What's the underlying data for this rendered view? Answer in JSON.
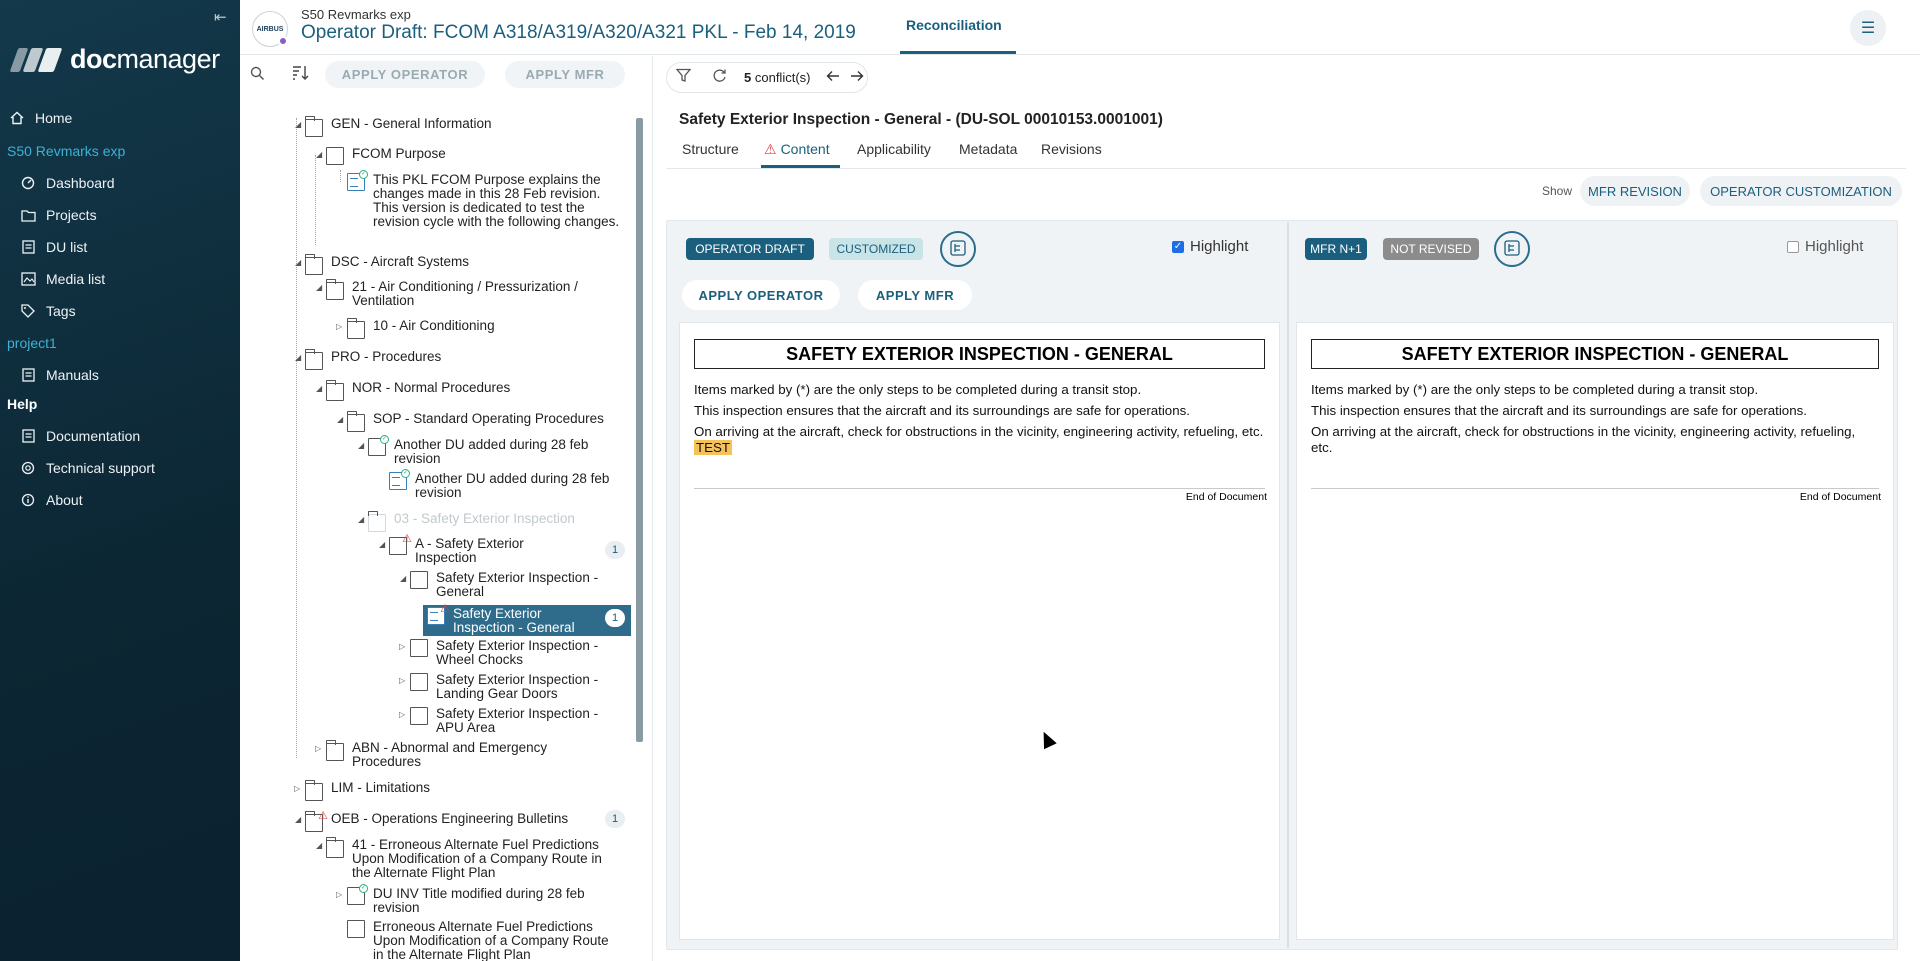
{
  "app": {
    "brand_word_a": "doc",
    "brand_word_b": "manager"
  },
  "sidebar": {
    "items_main": [
      {
        "label": "Home",
        "icon": "home-icon"
      }
    ],
    "section_project": "S50 Revmarks exp",
    "items_project": [
      {
        "label": "Dashboard",
        "icon": "dashboard-icon"
      },
      {
        "label": "Projects",
        "icon": "folder-icon"
      },
      {
        "label": "DU list",
        "icon": "list-icon"
      },
      {
        "label": "Media list",
        "icon": "media-icon"
      },
      {
        "label": "Tags",
        "icon": "tag-icon"
      }
    ],
    "section_project1": "project1",
    "items_project1": [
      {
        "label": "Manuals",
        "icon": "manual-icon"
      }
    ],
    "section_help": "Help",
    "items_help": [
      {
        "label": "Documentation",
        "icon": "document-icon"
      },
      {
        "label": "Technical support",
        "icon": "support-icon"
      },
      {
        "label": "About",
        "icon": "info-icon"
      }
    ]
  },
  "header": {
    "avatar_text": "AIRBUS",
    "breadcrumb": "S50 Revmarks exp",
    "title": "Operator Draft: FCOM A318/A319/A320/A321 PKL - Feb 14, 2019",
    "tab_label": "Reconciliation"
  },
  "tree_toolbar": {
    "apply_operator": "APPLY OPERATOR",
    "apply_mfr": "APPLY MFR"
  },
  "tree": [
    {
      "label": "GEN - General Information"
    },
    {
      "label": "FCOM Purpose"
    },
    {
      "label": "This PKL FCOM Purpose explains the changes made in this 28 Feb revision. This version is dedicated to test the revision cycle with the following changes."
    },
    {
      "label": "DSC - Aircraft Systems"
    },
    {
      "label": "21 - Air Conditioning / Pressurization / Ventilation"
    },
    {
      "label": "10 - Air Conditioning"
    },
    {
      "label": "PRO - Procedures"
    },
    {
      "label": "NOR - Normal Procedures"
    },
    {
      "label": "SOP - Standard Operating Procedures"
    },
    {
      "label": "Another DU added during 28 feb revision"
    },
    {
      "label": "Another DU added during 28 feb revision"
    },
    {
      "label": "03 - Safety Exterior Inspection"
    },
    {
      "label": "A - Safety Exterior Inspection",
      "count": "1"
    },
    {
      "label": "Safety Exterior Inspection - General"
    },
    {
      "label": "Safety Exterior Inspection - General",
      "count": "1"
    },
    {
      "label": "Safety Exterior Inspection - Wheel Chocks"
    },
    {
      "label": "Safety Exterior Inspection - Landing Gear Doors"
    },
    {
      "label": "Safety Exterior Inspection - APU Area"
    },
    {
      "label": "ABN - Abnormal and Emergency Procedures"
    },
    {
      "label": "LIM - Limitations"
    },
    {
      "label": "OEB - Operations Engineering Bulletins",
      "count": "1"
    },
    {
      "label": "41 - Erroneous Alternate Fuel Predictions Upon Modification of a Company Route in the Alternate Flight Plan"
    },
    {
      "label": "DU INV Title modified during 28 feb revision"
    },
    {
      "label": "Erroneous Alternate Fuel Predictions Upon Modification of a Company Route in the Alternate Flight Plan"
    }
  ],
  "conflicts": {
    "count": "5",
    "label": "conflict(s)"
  },
  "du": {
    "title": "Safety Exterior Inspection - General - (DU-SOL 00010153.0001001)",
    "tabs": [
      "Structure",
      "Content",
      "Applicability",
      "Metadata",
      "Revisions"
    ],
    "active_tab": "Content",
    "show_label": "Show",
    "show_mfr": "MFR REVISION",
    "show_operator": "OPERATOR CUSTOMIZATION"
  },
  "left_col": {
    "tag1": "OPERATOR DRAFT",
    "tag2": "CUSTOMIZED",
    "highlight_label": "Highlight",
    "highlight_checked": true,
    "apply_operator": "APPLY OPERATOR",
    "apply_mfr": "APPLY MFR",
    "doc_title": "SAFETY EXTERIOR INSPECTION - GENERAL",
    "line1": "Items marked by (*) are the only steps to be completed during a transit stop.",
    "line2": "This inspection ensures that the aircraft and its surroundings are safe for operations.",
    "line3": "On arriving at the aircraft, check for obstructions in the vicinity, engineering activity, refueling, etc.",
    "line3_added": "TEST",
    "eod": "End of Document"
  },
  "right_col": {
    "tag1": "MFR N+1",
    "tag2": "NOT REVISED",
    "highlight_label": "Highlight",
    "highlight_checked": false,
    "doc_title": "SAFETY EXTERIOR INSPECTION - GENERAL",
    "line1": "Items marked by (*) are the only steps to be completed during a transit stop.",
    "line2": "This inspection ensures that the aircraft and its surroundings are safe for operations.",
    "line3": "On arriving at the aircraft, check for obstructions in the vicinity, engineering activity, refueling, etc.",
    "eod": "End of Document"
  },
  "colors": {
    "sidebar_bg": "#0f2d3b",
    "accent": "#1b5f7e",
    "section": "#3cb2d4",
    "warning": "#e0403f",
    "ok": "#2bb27a",
    "added_highlight": "#f5c15a"
  }
}
